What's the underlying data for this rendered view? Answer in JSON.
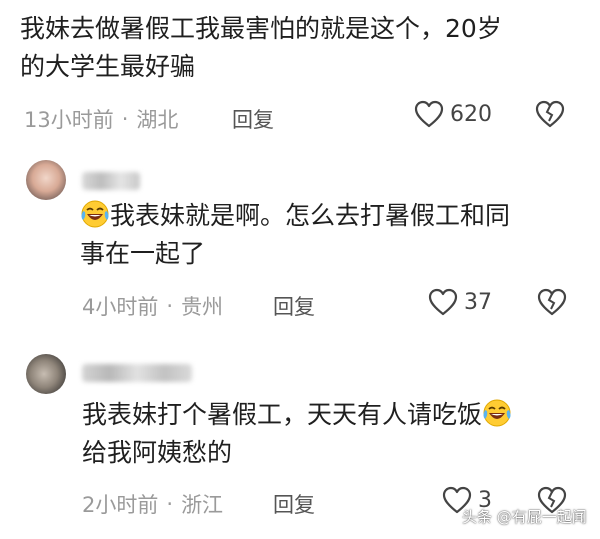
{
  "comments": [
    {
      "text_line1": "我妹去做暑假工我最害怕的就是这个，20岁",
      "text_line2": "的大学生最好骗",
      "time": "13小时前",
      "location": "湖北",
      "reply_label": "回复",
      "likes": "620"
    },
    {
      "text_line1": "我表妹就是啊。怎么去打暑假工和同",
      "text_line2": "事在一起了",
      "time": "4小时前",
      "location": "贵州",
      "reply_label": "回复",
      "likes": "37",
      "emoji": "laughing-crying-emoji"
    },
    {
      "text_line1": "我表妹打个暑假工，天天有人请吃饭",
      "text_line2": "给我阿姨愁的",
      "time": "2小时前",
      "location": "浙江",
      "reply_label": "回复",
      "likes": "3",
      "emoji": "laughing-crying-emoji"
    }
  ],
  "separator": "·",
  "watermark": "头条 @有屁一起闻"
}
